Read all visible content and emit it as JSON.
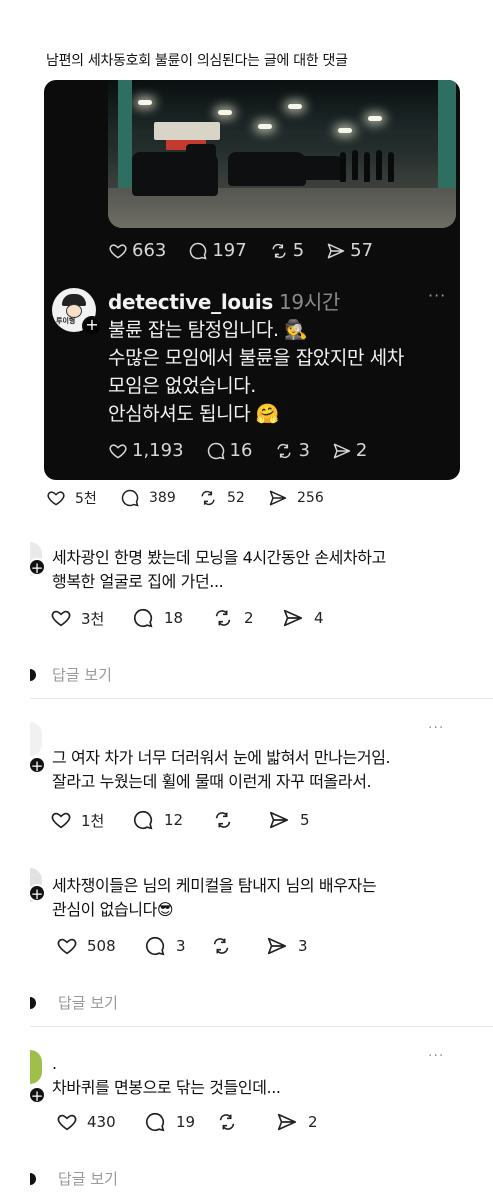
{
  "title": "남편의 세차동호회 불륜이 의심된다는 글에 대한 댓글",
  "embedded_post": {
    "photo_stats": {
      "likes": "663",
      "comments": "197",
      "reposts": "5",
      "shares": "57"
    },
    "username": "detective_louis",
    "time": "19시간",
    "more": "···",
    "avatar_text": "루이형",
    "lines": [
      "불륜 잡는 탐정입니다. 🕵",
      "수많은 모임에서 불륜을 잡았지만 세차",
      "모임은 없었습니다.",
      "안심하셔도 됩니다 🤗"
    ],
    "stats": {
      "likes": "1,193",
      "comments": "16",
      "reposts": "3",
      "shares": "2"
    }
  },
  "post_stats": {
    "likes": "5천",
    "comments": "389",
    "reposts": "52",
    "shares": "256"
  },
  "comments": [
    {
      "lines": [
        "세차광인 한명 봤는데 모닝을 4시간동안 손세차하고",
        "행복한 얼굴로 집에 가던..."
      ],
      "stats": {
        "likes": "3천",
        "comments": "18",
        "reposts": "2",
        "shares": "4"
      },
      "reply_label": "답글 보기"
    },
    {
      "lines": [
        "그 여자 차가 너무 더러워서 눈에 밟혀서 만나는거임.",
        "잘라고 누웠는데 휠에 물때 이런게 자꾸 떠올라서."
      ],
      "stats": {
        "likes": "1천",
        "comments": "12",
        "reposts": "",
        "shares": "5"
      },
      "more": "···"
    },
    {
      "lines": [
        "세차쟁이들은 님의 케미컬을 탐내지 님의 배우자는",
        "관심이 없습니다😎"
      ],
      "stats": {
        "likes": "508",
        "comments": "3",
        "reposts": "",
        "shares": "3"
      },
      "reply_label": "답글 보기"
    },
    {
      "prefix": ".",
      "lines": [
        "차바퀴를 면봉으로 닦는 것들인데..."
      ],
      "stats": {
        "likes": "430",
        "comments": "19",
        "reposts": "",
        "shares": "2"
      },
      "reply_label": "답글 보기",
      "more": "···"
    }
  ]
}
